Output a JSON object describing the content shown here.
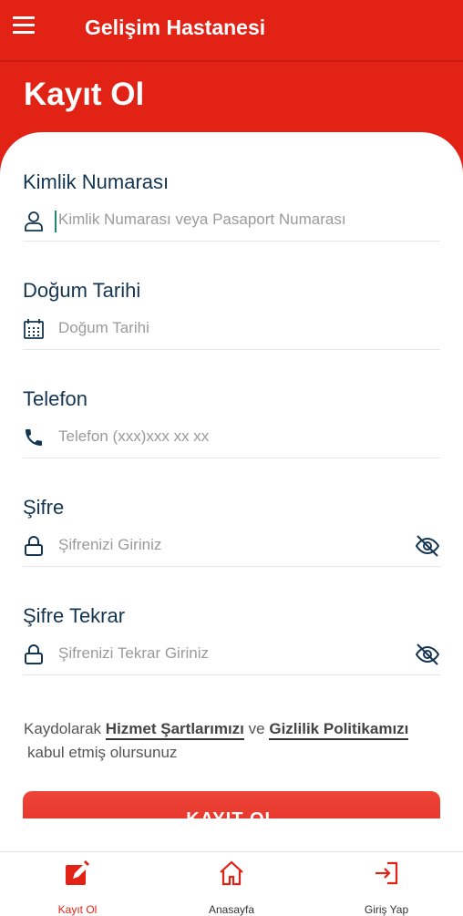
{
  "app": {
    "title": "Gelişim Hastanesi",
    "page_title": "Kayıt Ol"
  },
  "form": {
    "id": {
      "label": "Kimlik Numarası",
      "placeholder": "Kimlik Numarası veya Pasaport Numarası",
      "icon": "user-icon"
    },
    "birth": {
      "label": "Doğum Tarihi",
      "placeholder": "Doğum Tarihi",
      "icon": "calendar-icon"
    },
    "phone": {
      "label": "Telefon",
      "placeholder": "Telefon (xxx)xxx xx xx",
      "icon": "phone-icon"
    },
    "password": {
      "label": "Şifre",
      "placeholder": "Şifrenizi Giriniz",
      "icon": "lock-icon"
    },
    "password_confirm": {
      "label": "Şifre Tekrar",
      "placeholder": "Şifrenizi Tekrar Giriniz",
      "icon": "lock-icon"
    }
  },
  "terms": {
    "prefix": "Kaydolarak",
    "terms_link": "Hizmet Şartlarımızı",
    "conjunction": "ve",
    "privacy_link": "Gizlilik Politikamızı",
    "suffix": "kabul etmiş olursunuz"
  },
  "submit": {
    "label": "KAYIT OL"
  },
  "bottom_nav": [
    {
      "label": "Kayıt Ol",
      "icon": "edit-icon",
      "active": true
    },
    {
      "label": "Anasayfa",
      "icon": "home-icon",
      "active": false
    },
    {
      "label": "Giriş Yap",
      "icon": "login-icon",
      "active": false
    }
  ],
  "colors": {
    "brand": "#e32216",
    "label": "#143552",
    "placeholder": "#9a9a9a"
  }
}
